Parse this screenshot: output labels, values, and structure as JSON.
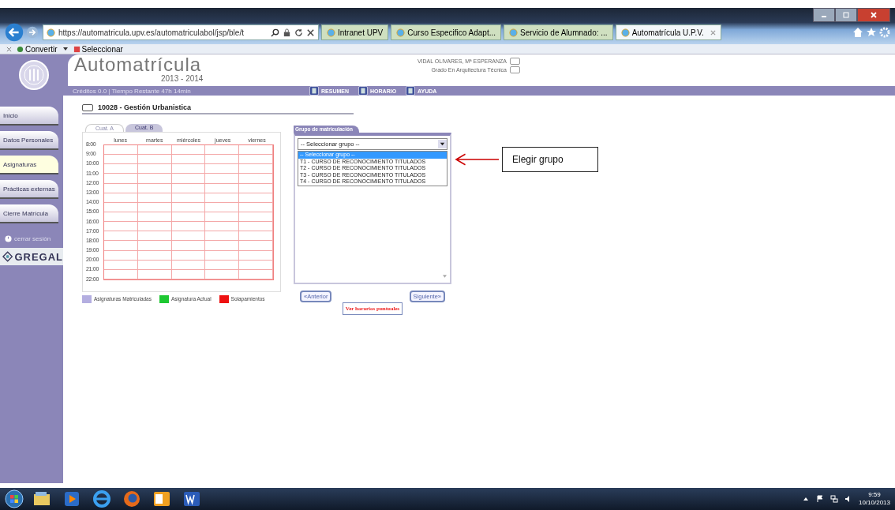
{
  "browser": {
    "address_url": "https://automatricula.upv.es/automatriculabol/jsp/ble/t",
    "tabs": [
      {
        "label": "Intranet UPV",
        "selected": false
      },
      {
        "label": "Curso Especifico Adapt...",
        "selected": false
      },
      {
        "label": "Servicio de Alumnado: ...",
        "selected": false
      },
      {
        "label": "Automatrícula U.P.V.",
        "selected": true
      }
    ],
    "toolbar": [
      "Convertir",
      "Seleccionar"
    ]
  },
  "header": {
    "title": "Automatrícula",
    "year": "2013 - 2014",
    "info": "Créditos 0.0 | Tiempo Restante 47h 14min",
    "user": {
      "label": "VIDAL OLIVARES, Mª ESPERANZA",
      "checked": false
    },
    "degree": {
      "label": "Grado En Arquitectura Técnica",
      "checked": false
    },
    "actions": [
      "RESUMEN",
      "HORARIO",
      "AYUDA"
    ]
  },
  "sidebar": {
    "items": [
      {
        "label": "Inicio",
        "selected": false
      },
      {
        "label": "Datos Personales",
        "selected": false
      },
      {
        "label": "Asignaturas",
        "selected": true
      },
      {
        "label": "Prácticas externas",
        "selected": false
      },
      {
        "label": "Cierre Matrícula",
        "selected": false
      }
    ],
    "logout": "cerrar sesión",
    "logo": "GREGAL"
  },
  "subject": {
    "label": "10028 - Gestión Urbanistica",
    "checked": false
  },
  "timetable": {
    "tabs": [
      {
        "label": "Cuat. A",
        "selected": true
      },
      {
        "label": "Cuat. B",
        "selected": false
      }
    ],
    "days": [
      "lunes",
      "martes",
      "miércoles",
      "jueves",
      "viernes"
    ],
    "hours": [
      "8:00",
      "9:00",
      "10:00",
      "11:00",
      "12:00",
      "13:00",
      "14:00",
      "15:00",
      "16:00",
      "17:00",
      "18:00",
      "19:00",
      "20:00",
      "21:00",
      "22:00"
    ],
    "legend": [
      {
        "label": "Asignaturas Matriculadas",
        "color": "#b4aee0"
      },
      {
        "label": "Asignatura Actual",
        "color": "#1ec832"
      },
      {
        "label": "Solapamientos",
        "color": "#ee1111"
      }
    ]
  },
  "group": {
    "title": "Grupo de matriculación",
    "value": "-- Seleccionar grupo --",
    "options": [
      {
        "label": "-- Seleccionar grupo --",
        "selected": true
      },
      {
        "label": "T1 - CURSO DE RECONOCIMIENTO TITULADOS",
        "selected": false
      },
      {
        "label": "T2 - CURSO DE RECONOCIMIENTO TITULADOS",
        "selected": false
      },
      {
        "label": "T3 - CURSO DE RECONOCIMIENTO TITULADOS",
        "selected": false
      },
      {
        "label": "T4 - CURSO DE RECONOCIMIENTO TITULADOS",
        "selected": false
      }
    ],
    "prev": "«Anterior",
    "next": "Siguiente»",
    "link": "Ver horarios puntuales"
  },
  "callout": "Elegir grupo",
  "taskbar": {
    "time": "9:59",
    "date": "10/10/2013"
  }
}
